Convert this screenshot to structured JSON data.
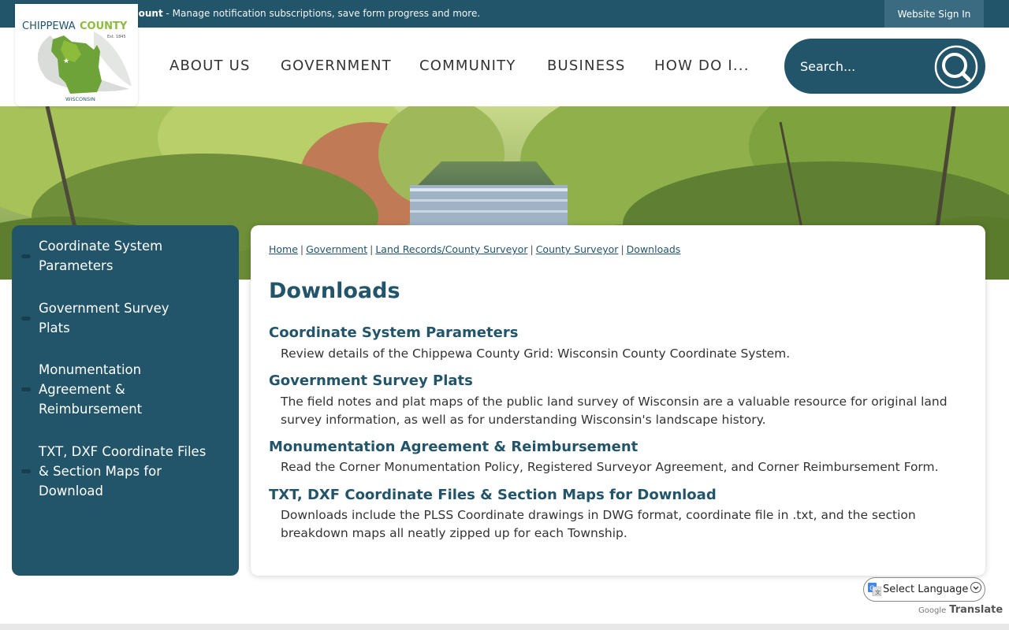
{
  "topbar": {
    "create_account": "Create a Website Account",
    "create_account_rest": " - Manage notification subscriptions, save form progress and more.",
    "sign_in": "Website Sign In"
  },
  "logo": {
    "line1": "CHIPPEWA",
    "line2": "COUNTY",
    "est": "Est. 1845",
    "state": "WISCONSIN"
  },
  "nav": {
    "items": [
      {
        "label": "ABOUT US"
      },
      {
        "label": "GOVERNMENT"
      },
      {
        "label": "COMMUNITY"
      },
      {
        "label": "BUSINESS"
      },
      {
        "label": "HOW DO I..."
      }
    ]
  },
  "search": {
    "placeholder": "Search..."
  },
  "sidebar": {
    "items": [
      {
        "label": "Coordinate System Parameters"
      },
      {
        "label": "Government Survey Plats"
      },
      {
        "label": "Monumentation Agreement & Reimbursement"
      },
      {
        "label": "TXT, DXF Coordinate Files & Section Maps for Download"
      }
    ]
  },
  "breadcrumb": [
    {
      "label": "Home"
    },
    {
      "label": "Government"
    },
    {
      "label": "Land Records/County Surveyor"
    },
    {
      "label": "County Surveyor"
    },
    {
      "label": "Downloads"
    }
  ],
  "breadcrumb_sep": "|",
  "main": {
    "title": "Downloads",
    "entries": [
      {
        "title": "Coordinate System Parameters",
        "desc": "Review details of the Chippewa County Grid: Wisconsin County Coordinate System."
      },
      {
        "title": "Government Survey Plats",
        "desc": "The field notes and plat maps of the public land survey of Wisconsin are a valuable resource for original land survey information, as well as for understanding Wisconsin's landscape history."
      },
      {
        "title": "Monumentation Agreement & Reimbursement",
        "desc": "Read the Corner Monumentation Policy, Registered Surveyor Agreement, and Corner Reimbursement Form."
      },
      {
        "title": "TXT, DXF Coordinate Files & Section Maps for Download",
        "desc": "Downloads include the PLSS Coordinate drawings in DWG format, coordinate file in .txt, and the section breakdown maps all neatly zipped up for each Township."
      }
    ]
  },
  "translate": {
    "select_label": "Select Language",
    "powered_by": "Google",
    "translate_label": "Translate"
  },
  "colors": {
    "primary": "#22546a",
    "accent_green": "#8dbb3c"
  }
}
